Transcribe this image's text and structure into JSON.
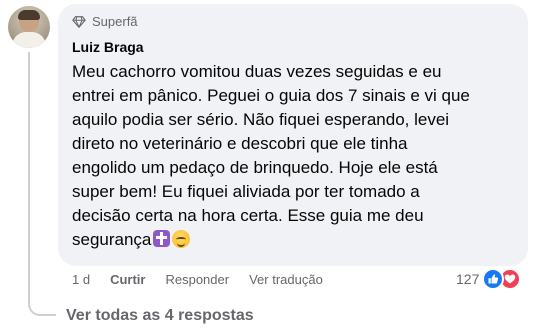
{
  "comment": {
    "badge_label": "Superfã",
    "author": "Luiz Braga",
    "text_lines": [
      "Meu cachorro vomitou duas vezes seguidas e eu",
      "entrei em pânico. Peguei o guia dos 7 sinais e vi que",
      "aquilo podia ser sério. Não fiquei esperando, levei",
      "direto no veterinário e descobri que ele tinha",
      "engolido um pedaço de brinquedo. Hoje ele está",
      "super bem! Eu fiquei aliviada por ter tomado a",
      "decisão certa na hora certa. Esse guia me deu",
      "segurança"
    ],
    "emojis": [
      "latin-cross-emoji",
      "relieved-face-emoji"
    ]
  },
  "actions": {
    "time": "1 d",
    "like_label": "Curtir",
    "reply_label": "Responder",
    "translate_label": "Ver tradução"
  },
  "reactions": {
    "count": "127",
    "icons": [
      "like-icon",
      "love-icon"
    ],
    "colors": {
      "like": "#1877f2",
      "love": "#f33e58"
    }
  },
  "replies": {
    "view_all_label": "Ver todas as 4 respostas"
  },
  "colors": {
    "bubble_bg": "#f0f2f5",
    "secondary_text": "#65676b",
    "primary_text": "#050505",
    "thread_line": "#ced0d4"
  }
}
